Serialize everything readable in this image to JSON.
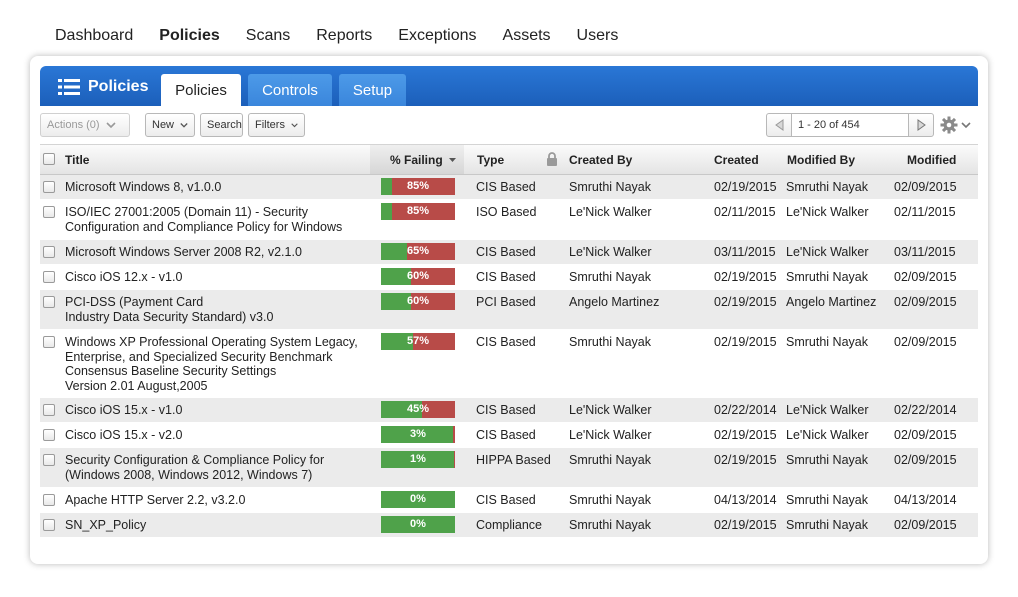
{
  "topnav": [
    {
      "label": "Dashboard",
      "active": false
    },
    {
      "label": "Policies",
      "active": true
    },
    {
      "label": "Scans",
      "active": false
    },
    {
      "label": "Reports",
      "active": false
    },
    {
      "label": "Exceptions",
      "active": false
    },
    {
      "label": "Assets",
      "active": false
    },
    {
      "label": "Users",
      "active": false
    }
  ],
  "header": {
    "brand_icon": "list-icon",
    "brand_label": "Policies",
    "tabs": [
      {
        "label": "Policies",
        "active": true
      },
      {
        "label": "Controls",
        "active": false
      },
      {
        "label": "Setup",
        "active": false
      }
    ]
  },
  "toolbar": {
    "actions_label": "Actions (0)",
    "new_label": "New",
    "search_label": "Search",
    "filters_label": "Filters",
    "pager_value": "1 - 20 of 454",
    "settings_icon": "gear-icon"
  },
  "table": {
    "columns": {
      "title": "Title",
      "failing": "% Failing",
      "type": "Type",
      "created_by": "Created By",
      "created": "Created",
      "modified_by": "Modified By",
      "modified": "Modified"
    },
    "rows": [
      {
        "title": "Microsoft Windows 8, v1.0.0",
        "failing": 85,
        "failing_label": "85%",
        "type": "CIS Based",
        "created_by": "Smruthi Nayak",
        "created": "02/19/2015",
        "modified_by": "Smruthi Nayak",
        "modified": "02/09/2015"
      },
      {
        "title": "ISO/IEC 27001:2005 (Domain 11) - Security Configuration and Compliance Policy for Windows",
        "failing": 85,
        "failing_label": "85%",
        "type": "ISO Based",
        "created_by": "Le'Nick Walker",
        "created": "02/11/2015",
        "modified_by": "Le'Nick Walker",
        "modified": "02/11/2015"
      },
      {
        "title": "Microsoft Windows Server 2008 R2, v2.1.0",
        "failing": 65,
        "failing_label": "65%",
        "type": "CIS Based",
        "created_by": "Le'Nick Walker",
        "created": "03/11/2015",
        "modified_by": "Le'Nick Walker",
        "modified": "03/11/2015"
      },
      {
        "title": "Cisco iOS 12.x - v1.0",
        "failing": 60,
        "failing_label": "60%",
        "type": "CIS Based",
        "created_by": "Smruthi Nayak",
        "created": "02/19/2015",
        "modified_by": "Smruthi Nayak",
        "modified": "02/09/2015"
      },
      {
        "title": "PCI-DSS (Payment Card\nIndustry Data Security Standard) v3.0",
        "failing": 60,
        "failing_label": "60%",
        "type": "PCI Based",
        "created_by": "Angelo Martinez",
        "created": "02/19/2015",
        "modified_by": "Angelo Martinez",
        "modified": "02/09/2015"
      },
      {
        "title": "Windows XP Professional Operating System Legacy,\nEnterprise, and Specialized Security Benchmark\nConsensus Baseline Security Settings\nVersion 2.01 August,2005",
        "failing": 57,
        "failing_label": "57%",
        "type": "CIS Based",
        "created_by": "Smruthi Nayak",
        "created": "02/19/2015",
        "modified_by": "Smruthi Nayak",
        "modified": "02/09/2015"
      },
      {
        "title": "Cisco iOS 15.x - v1.0",
        "failing": 45,
        "failing_label": "45%",
        "type": "CIS Based",
        "created_by": "Le'Nick Walker",
        "created": "02/22/2014",
        "modified_by": "Le'Nick Walker",
        "modified": "02/22/2014"
      },
      {
        "title": "Cisco iOS 15.x - v2.0",
        "failing": 3,
        "failing_label": "3%",
        "type": "CIS Based",
        "created_by": "Le'Nick Walker",
        "created": "02/19/2015",
        "modified_by": "Le'Nick Walker",
        "modified": "02/09/2015"
      },
      {
        "title": "Security Configuration & Compliance Policy for\n(Windows 2008, Windows 2012, Windows 7)",
        "failing": 1,
        "failing_label": "1%",
        "type": "HIPPA Based",
        "created_by": "Smruthi Nayak",
        "created": "02/19/2015",
        "modified_by": "Smruthi Nayak",
        "modified": "02/09/2015"
      },
      {
        "title": "Apache HTTP Server 2.2, v3.2.0",
        "failing": 0,
        "failing_label": "0%",
        "type": "CIS Based",
        "created_by": "Smruthi Nayak",
        "created": "04/13/2014",
        "modified_by": "Smruthi Nayak",
        "modified": "04/13/2014"
      },
      {
        "title": "SN_XP_Policy",
        "failing": 0,
        "failing_label": "0%",
        "type": "Compliance",
        "created_by": "Smruthi Nayak",
        "created": "02/19/2015",
        "modified_by": "Smruthi Nayak",
        "modified": "02/09/2015"
      }
    ]
  },
  "colors": {
    "header_blue": "#1c5fba",
    "pass_green": "#4fa24a",
    "fail_red": "#b84b48",
    "row_alt": "#ebebeb"
  }
}
